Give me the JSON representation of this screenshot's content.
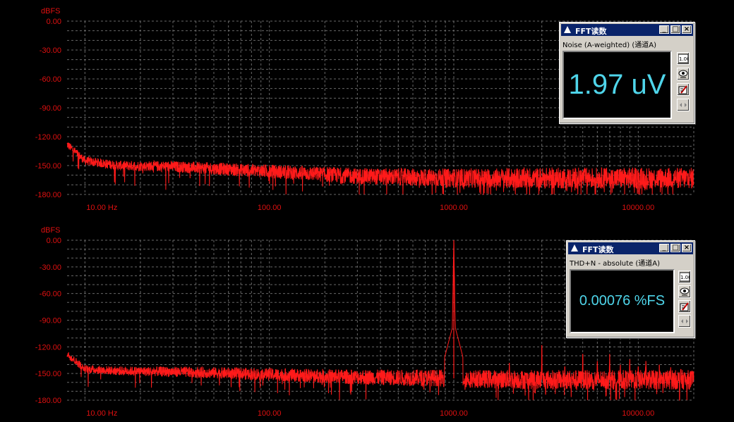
{
  "colors": {
    "trace": "#ff1a1a",
    "axis_text": "#e01010",
    "grid": "#8a8a8a",
    "readout_text": "#4fd5ea"
  },
  "chart_data": [
    {
      "type": "line",
      "ylabel": "dBFS",
      "x_scale": "log",
      "xlim": [
        8,
        20000
      ],
      "ylim": [
        -180,
        0
      ],
      "y_ticks": [
        "0.00",
        "-30.00",
        "-60.00",
        "-90.00",
        "-120.00",
        "-150.00",
        "-180.00"
      ],
      "x_ticks": [
        "10.00 Hz",
        "100.00",
        "1000.00",
        "10000.00"
      ],
      "grid": true,
      "series": [
        {
          "noise_floor_points": [
            [
              8,
              -128
            ],
            [
              10,
              -145
            ],
            [
              15,
              -150
            ],
            [
              30,
              -151
            ],
            [
              100,
              -156
            ],
            [
              300,
              -161
            ],
            [
              1000,
              -163
            ],
            [
              3000,
              -163
            ],
            [
              20000,
              -163
            ]
          ],
          "peaks": []
        }
      ]
    },
    {
      "type": "line",
      "ylabel": "dBFS",
      "x_scale": "log",
      "xlim": [
        8,
        20000
      ],
      "ylim": [
        -180,
        0
      ],
      "y_ticks": [
        "0.00",
        "-30.00",
        "-60.00",
        "-90.00",
        "-120.00",
        "-150.00",
        "-180.00"
      ],
      "x_ticks": [
        "10.00 Hz",
        "100.00",
        "1000.00",
        "10000.00"
      ],
      "grid": true,
      "series": [
        {
          "noise_floor_points": [
            [
              8,
              -128
            ],
            [
              10,
              -145
            ],
            [
              15,
              -147
            ],
            [
              30,
              -148
            ],
            [
              100,
              -151
            ],
            [
              300,
              -154
            ],
            [
              800,
              -155
            ],
            [
              1200,
              -156
            ],
            [
              3000,
              -157
            ],
            [
              20000,
              -157
            ]
          ],
          "peaks": [
            [
              1000,
              0
            ],
            [
              2000,
              -138
            ],
            [
              3000,
              -118
            ],
            [
              4000,
              -142
            ],
            [
              5000,
              -128
            ],
            [
              6000,
              -136
            ],
            [
              7000,
              -128
            ],
            [
              8000,
              -140
            ],
            [
              9000,
              -134
            ],
            [
              10000,
              -142
            ],
            [
              11000,
              -136
            ],
            [
              13000,
              -140
            ],
            [
              15000,
              -143
            ],
            [
              17000,
              -145
            ]
          ]
        }
      ]
    }
  ],
  "readout_top": {
    "title": "FFT读数",
    "subtitle": "Noise (A-weighted) (通道A)",
    "value": "1.97 uV",
    "icons": [
      "readout-units-icon",
      "eye-icon",
      "chart-edit-icon",
      "swap-arrows-icon"
    ],
    "units_btn_text": "1.00"
  },
  "readout_bottom": {
    "title": "FFT读数",
    "subtitle": "THD+N - absolute (通道A)",
    "value": "0.00076 %FS",
    "icons": [
      "readout-units-icon",
      "eye-icon",
      "chart-edit-icon",
      "swap-arrows-icon"
    ],
    "units_btn_text": "1.00"
  }
}
